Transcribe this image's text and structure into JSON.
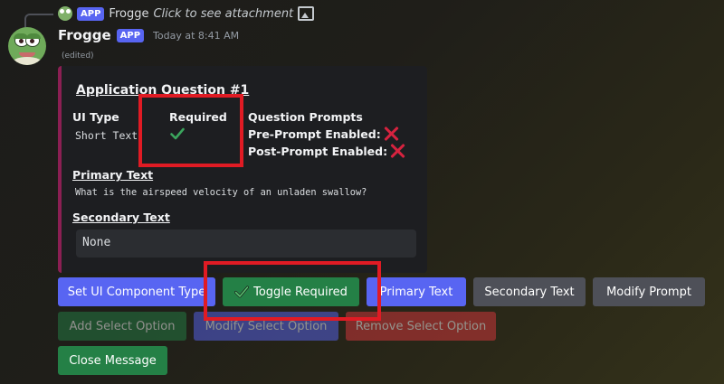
{
  "reply": {
    "username": "Frogge",
    "tag": "APP",
    "link_text": "Click to see attachment",
    "icons": [
      "frog-avatar-icon",
      "image-icon"
    ]
  },
  "message": {
    "username": "Frogge",
    "tag": "APP",
    "timestamp": "Today at 8:41 AM",
    "edited": "(edited)"
  },
  "embed": {
    "accent_color": "#8b1f53",
    "title": "Application Question #1",
    "ui_type_label": "UI Type",
    "ui_type_value": "Short Text",
    "required_label": "Required",
    "required_value_icon": "check-icon",
    "question_prompts_label": "Question Prompts",
    "pre_prompt_label": "Pre-Prompt Enabled:",
    "pre_prompt_value_icon": "x-icon",
    "post_prompt_label": "Post-Prompt Enabled:",
    "post_prompt_value_icon": "x-icon",
    "primary_text_label": "Primary Text",
    "primary_text_value": "What is the airspeed velocity of an unladen swallow?",
    "secondary_text_label": "Secondary Text",
    "secondary_text_value": "None"
  },
  "buttons": {
    "row1": [
      {
        "label": "Set UI Component Type",
        "style": "blurple",
        "enabled": true
      },
      {
        "label": "Toggle Required",
        "style": "green",
        "enabled": true,
        "icon": "check-icon"
      },
      {
        "label": "Primary Text",
        "style": "blurple",
        "enabled": true
      },
      {
        "label": "Secondary Text",
        "style": "grey",
        "enabled": true
      },
      {
        "label": "Modify Prompt",
        "style": "grey",
        "enabled": true
      }
    ],
    "row2": [
      {
        "label": "Add Select Option",
        "style": "green",
        "enabled": false
      },
      {
        "label": "Modify Select Option",
        "style": "blurple",
        "enabled": false
      },
      {
        "label": "Remove Select Option",
        "style": "red",
        "enabled": false
      }
    ],
    "row3": [
      {
        "label": "Close Message",
        "style": "green",
        "enabled": true
      }
    ]
  },
  "annotation_color": "#e01b24"
}
